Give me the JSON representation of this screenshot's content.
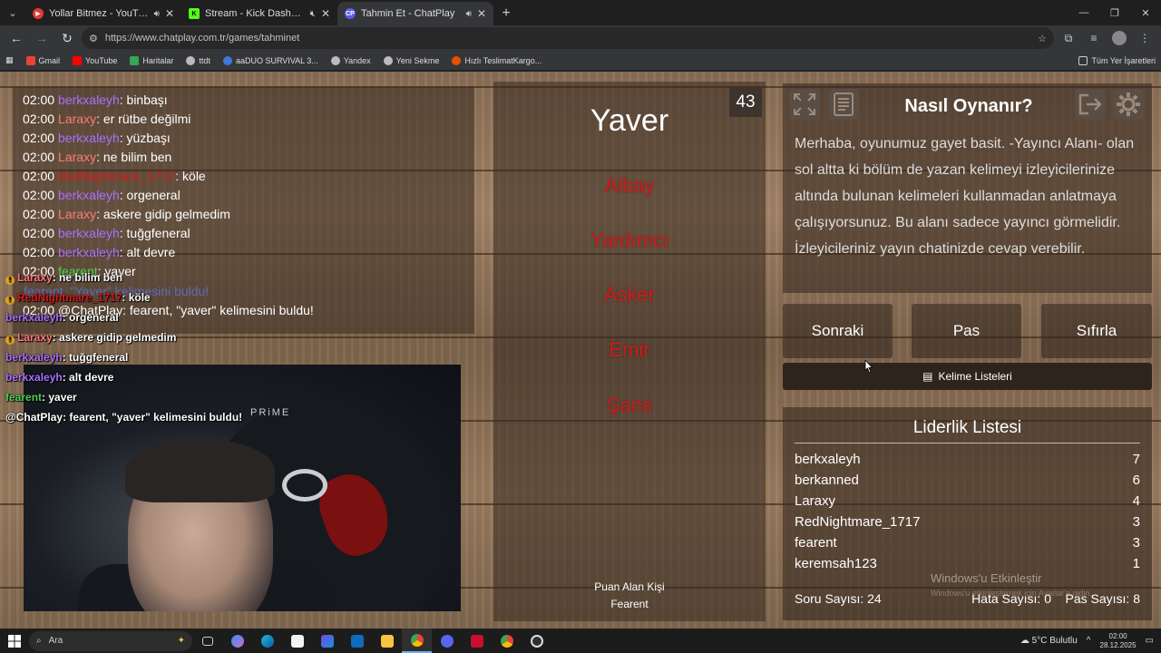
{
  "browser": {
    "tabs": [
      {
        "title": "Yollar Bitmez - YouTube Music",
        "favicon_color": "#e53935",
        "muted": false
      },
      {
        "title": "Stream - Kick Dashboard",
        "favicon_color": "#53fc18",
        "muted": true
      },
      {
        "title": "Tahmin Et - ChatPlay",
        "favicon_color": "#5b5ce2",
        "muted": false
      }
    ],
    "url": "https://www.chatplay.com.tr/games/tahminet",
    "bookmarks": [
      "Gmail",
      "YouTube",
      "Haritalar",
      "ttdt",
      "aaDUO SURVIVAL 3...",
      "Yandex",
      "Yeni Sekme",
      "Hızlı TeslimatKargo..."
    ],
    "all_bookmarks": "Tüm Yer İşaretleri"
  },
  "chat": {
    "lines": [
      {
        "time": "02:00",
        "user": "berkxaleyh",
        "color": "#a970ff",
        "msg": ": binbaşı"
      },
      {
        "time": "02:00",
        "user": "Laraxy",
        "color": "#ff7a7a",
        "msg": ": er rütbe değilmi"
      },
      {
        "time": "02:00",
        "user": "berkxaleyh",
        "color": "#a970ff",
        "msg": ": yüzbaşı"
      },
      {
        "time": "02:00",
        "user": "Laraxy",
        "color": "#ff7a7a",
        "msg": ": ne bilim ben"
      },
      {
        "time": "02:00",
        "user": "RedNightmare_1717",
        "color": "#d41a1a",
        "msg": ": köle"
      },
      {
        "time": "02:00",
        "user": "berkxaleyh",
        "color": "#a970ff",
        "msg": ": orgeneral"
      },
      {
        "time": "02:00",
        "user": "Laraxy",
        "color": "#ff7a7a",
        "msg": ": askere gidip gelmedim"
      },
      {
        "time": "02:00",
        "user": "berkxaleyh",
        "color": "#a970ff",
        "msg": ": tuğgfeneral"
      },
      {
        "time": "02:00",
        "user": "berkxaleyh",
        "color": "#a970ff",
        "msg": ": alt devre"
      },
      {
        "time": "02:00",
        "user": "fearent",
        "color": "#4cd14c",
        "msg": ": yaver"
      },
      {
        "time": "02:00",
        "user": "@ChatPlay",
        "color": "#ffffff",
        "msg": ": fearent, \"yaver\" kelimesini buldu!"
      }
    ],
    "ghost_line": "fearent, \"Yaver\" kelimesini buldu!"
  },
  "overlay_chat": [
    {
      "user": "Laraxy",
      "color": "#ff7a7a",
      "msg": ": ne bilim ben",
      "badge": true
    },
    {
      "user": "RedNightmare_1717",
      "color": "#d41a1a",
      "msg": ": köle",
      "badge": true
    },
    {
      "user": "berkxaleyh",
      "color": "#a970ff",
      "msg": ": orgeneral",
      "badge": false
    },
    {
      "user": "Laraxy",
      "color": "#ff7a7a",
      "msg": ": askere gidip gelmedim",
      "badge": true
    },
    {
      "user": "berkxaleyh",
      "color": "#a970ff",
      "msg": ": tuğgfeneral",
      "badge": false
    },
    {
      "user": "berkxaleyh",
      "color": "#a970ff",
      "msg": ": alt devre",
      "badge": false
    },
    {
      "user": "fearent",
      "color": "#4cd14c",
      "msg": ": yaver",
      "badge": false
    },
    {
      "user": "@ChatPlay",
      "color": "#ffffff",
      "msg": ": fearent, \"yaver\" kelimesini buldu!",
      "badge": false
    }
  ],
  "webcam": {
    "brand": "PRiME"
  },
  "game": {
    "counter": "43",
    "word": "Yaver",
    "forbidden": [
      "Albay",
      "Yardımcı",
      "Asker",
      "Emir",
      "Şans"
    ],
    "scorer_label": "Puan Alan Kişi",
    "scorer_name": "Fearent"
  },
  "info": {
    "title": "Nasıl Oynanır?",
    "text": "Merhaba, oyunumuz gayet basit. -Yayıncı Alanı- olan sol altta ki bölüm de yazan kelimeyi izleyicilerinize altında bulunan kelimeleri kullanmadan anlatmaya çalışıyorsunuz. Bu alanı sadece yayıncı görmelidir. İzleyicileriniz yayın chatinizde cevap verebilir."
  },
  "buttons": {
    "next": "Sonraki",
    "pass": "Pas",
    "reset": "Sıfırla",
    "word_lists": "Kelime Listeleri"
  },
  "leaderboard": {
    "title": "Liderlik Listesi",
    "rows": [
      {
        "name": "berkxaleyh",
        "score": "7"
      },
      {
        "name": "berkanned",
        "score": "6"
      },
      {
        "name": "Laraxy",
        "score": "4"
      },
      {
        "name": "RedNightmare_1717",
        "score": "3"
      },
      {
        "name": "fearent",
        "score": "3"
      },
      {
        "name": "keremsah123",
        "score": "1"
      }
    ],
    "questions": "Soru Sayısı: 24",
    "errors": "Hata Sayısı: 0",
    "passes": "Pas Sayısı: 8"
  },
  "windows_watermark": {
    "line1": "Windows'u Etkinleştir",
    "line2": "Windows'u etkinleştirmek için Ayarlar'a gidin."
  },
  "taskbar": {
    "search": "Ara",
    "weather": "5°C  Bulutlu",
    "time": "02:00",
    "date": "28.12.2025"
  }
}
